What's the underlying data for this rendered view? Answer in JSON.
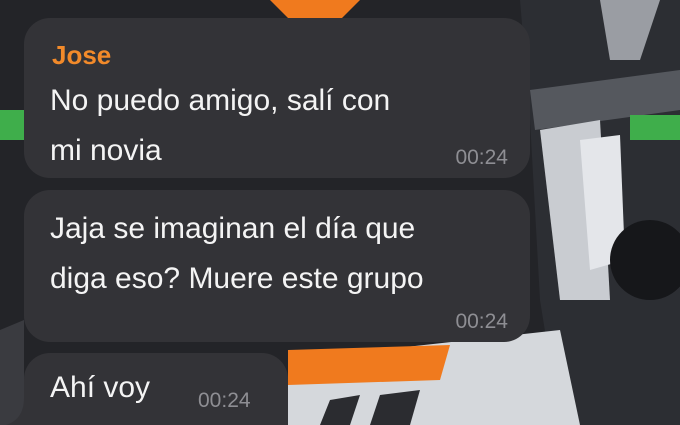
{
  "chat": {
    "messages": [
      {
        "sender": "Jose",
        "text": "No puedo amigo, salí con\nmi novia",
        "time": "00:24"
      },
      {
        "text": "Jaja se imaginan el día que\ndiga eso? Muere este grupo",
        "time": "00:24"
      },
      {
        "text": "Ahí voy",
        "time": "00:24"
      }
    ]
  },
  "colors": {
    "bubble": "#333337",
    "sender_name": "#f28a2a",
    "timestamp": "#8e8e93",
    "wallpaper_accent": "#f07a1e"
  },
  "wallpaper": {
    "subject": "race-car-image"
  }
}
